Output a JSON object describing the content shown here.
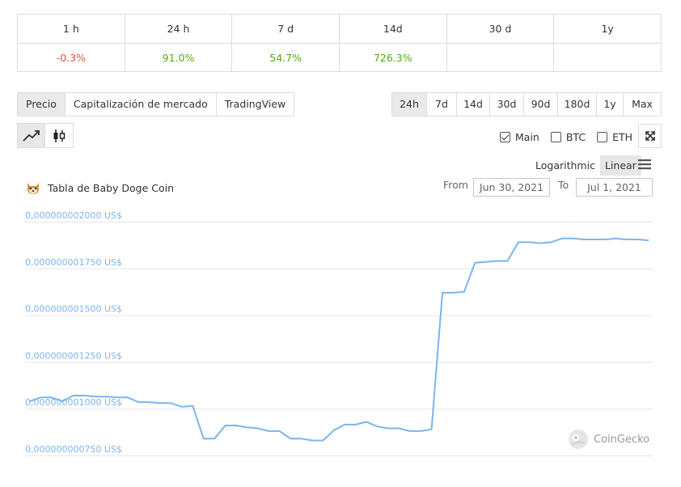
{
  "changes": {
    "headers": [
      "1 h",
      "24 h",
      "7 d",
      "14d",
      "30 d",
      "1y"
    ],
    "values": [
      "-0.3%",
      "91.0%",
      "54.7%",
      "726.3%",
      "",
      ""
    ],
    "value_signs": [
      "neg",
      "pos",
      "pos",
      "pos",
      "",
      ""
    ]
  },
  "tabs": [
    {
      "label": "Precio",
      "active": true
    },
    {
      "label": "Capitalización de mercado",
      "active": false
    },
    {
      "label": "TradingView",
      "active": false
    }
  ],
  "ranges": [
    {
      "label": "24h",
      "active": true
    },
    {
      "label": "7d",
      "active": false
    },
    {
      "label": "14d",
      "active": false
    },
    {
      "label": "30d",
      "active": false
    },
    {
      "label": "90d",
      "active": false
    },
    {
      "label": "180d",
      "active": false
    },
    {
      "label": "1y",
      "active": false
    },
    {
      "label": "Max",
      "active": false
    }
  ],
  "chart_types": [
    {
      "icon": "line-chart-icon",
      "active": true
    },
    {
      "icon": "candlestick-icon",
      "active": false
    }
  ],
  "series_toggles": [
    {
      "label": "Main",
      "checked": true
    },
    {
      "label": "BTC",
      "checked": false
    },
    {
      "label": "ETH",
      "checked": false
    }
  ],
  "scale": {
    "logarithmic": "Logarithmic",
    "linear": "Linear",
    "active": "Linear"
  },
  "icons": {
    "expand": "expand-icon",
    "menu": "hamburger-menu-icon",
    "coin": "baby-doge-icon",
    "brand": "coingecko-logo-icon"
  },
  "chart_title": "Tabla de Baby Doge Coin",
  "date_range": {
    "from_label": "From",
    "from": "Jun 30, 2021",
    "to_label": "To",
    "to": "Jul 1, 2021"
  },
  "credit": "CoinGecko",
  "colors": {
    "line": "#7cb5ec",
    "negative": "#e15241",
    "positive": "#4eaf0a",
    "grid": "#e6e6e6"
  },
  "chart_data": {
    "type": "line",
    "title": "Tabla de Baby Doge Coin",
    "y_tick_labels": [
      "0,000000000750 US$",
      "0,000000001000 US$",
      "0,000000001250 US$",
      "0,000000001500 US$",
      "0,000000001750 US$",
      "0,000000002000 US$"
    ],
    "y_ticks": [
      7.5e-10,
      1e-09,
      1.25e-09,
      1.5e-09,
      1.75e-09,
      2e-09
    ],
    "ylim": [
      7.5e-10,
      2e-09
    ],
    "x_range": [
      "Jun 30, 2021",
      "Jul 1, 2021"
    ],
    "grid": true,
    "series": [
      {
        "values": [
          1.04e-09,
          1.06e-09,
          1.06e-09,
          1.04e-09,
          1.07e-09,
          1.07e-09,
          1.065e-09,
          1.065e-09,
          1.06e-09,
          1.06e-09,
          1.035e-09,
          1.035e-09,
          1.03e-09,
          1.03e-09,
          1.01e-09,
          1.015e-09,
          8.4e-10,
          8.4e-10,
          9.1e-10,
          9.1e-10,
          9e-10,
          8.95e-10,
          8.8e-10,
          8.8e-10,
          8.4e-10,
          8.4e-10,
          8.3e-10,
          8.3e-10,
          8.85e-10,
          9.15e-10,
          9.15e-10,
          9.3e-10,
          9.05e-10,
          8.95e-10,
          8.95e-10,
          8.8e-10,
          8.8e-10,
          8.9e-10,
          1.62e-09,
          1.62e-09,
          1.625e-09,
          1.78e-09,
          1.785e-09,
          1.79e-09,
          1.79e-09,
          1.89e-09,
          1.89e-09,
          1.885e-09,
          1.89e-09,
          1.91e-09,
          1.91e-09,
          1.905e-09,
          1.905e-09,
          1.905e-09,
          1.91e-09,
          1.905e-09,
          1.905e-09,
          1.9e-09
        ]
      }
    ]
  }
}
